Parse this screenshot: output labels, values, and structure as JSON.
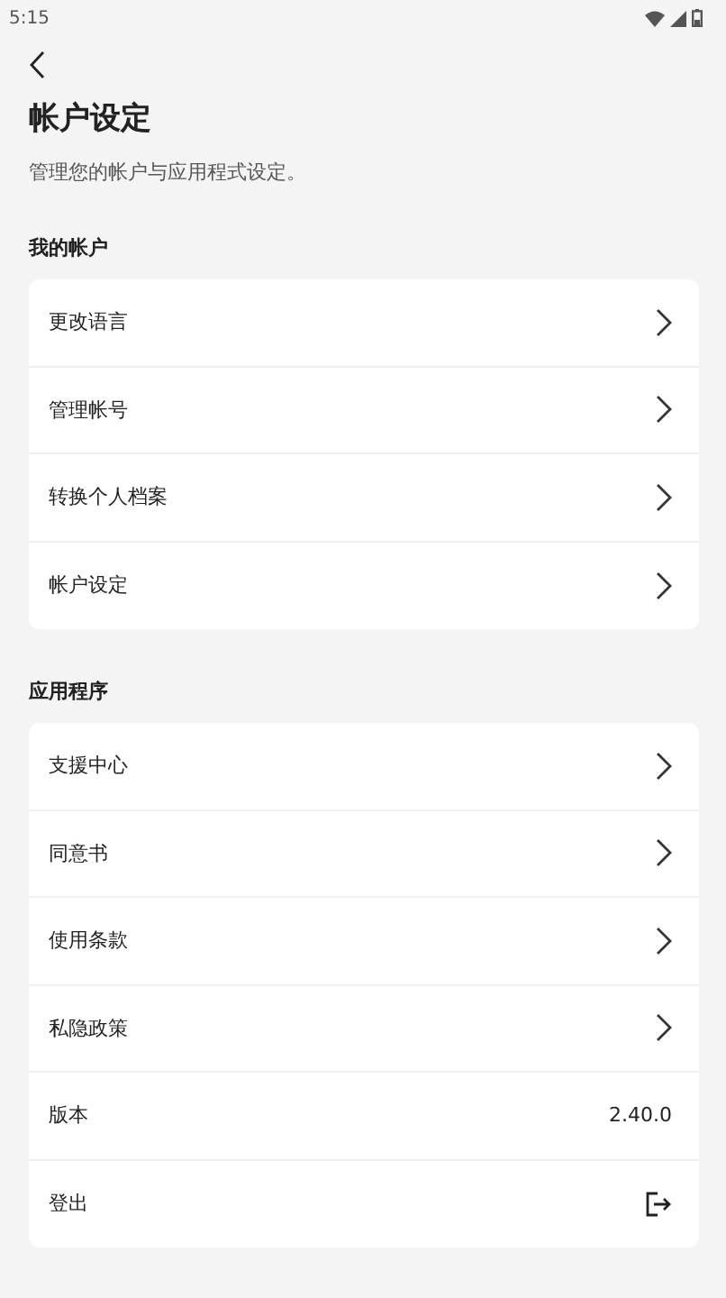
{
  "status_bar": {
    "time": "5:15"
  },
  "header": {
    "title": "帐户设定",
    "subtitle": "管理您的帐户与应用程式设定。"
  },
  "sections": [
    {
      "heading": "我的帐户",
      "items": [
        {
          "label": "更改语言",
          "kind": "chevron"
        },
        {
          "label": "管理帐号",
          "kind": "chevron"
        },
        {
          "label": "转换个人档案",
          "kind": "chevron"
        },
        {
          "label": "帐户设定",
          "kind": "chevron"
        }
      ]
    },
    {
      "heading": "应用程序",
      "items": [
        {
          "label": "支援中心",
          "kind": "chevron"
        },
        {
          "label": "同意书",
          "kind": "chevron"
        },
        {
          "label": "使用条款",
          "kind": "chevron"
        },
        {
          "label": "私隐政策",
          "kind": "chevron"
        },
        {
          "label": "版本",
          "kind": "value",
          "value": "2.40.0"
        },
        {
          "label": "登出",
          "kind": "logout"
        }
      ]
    }
  ]
}
